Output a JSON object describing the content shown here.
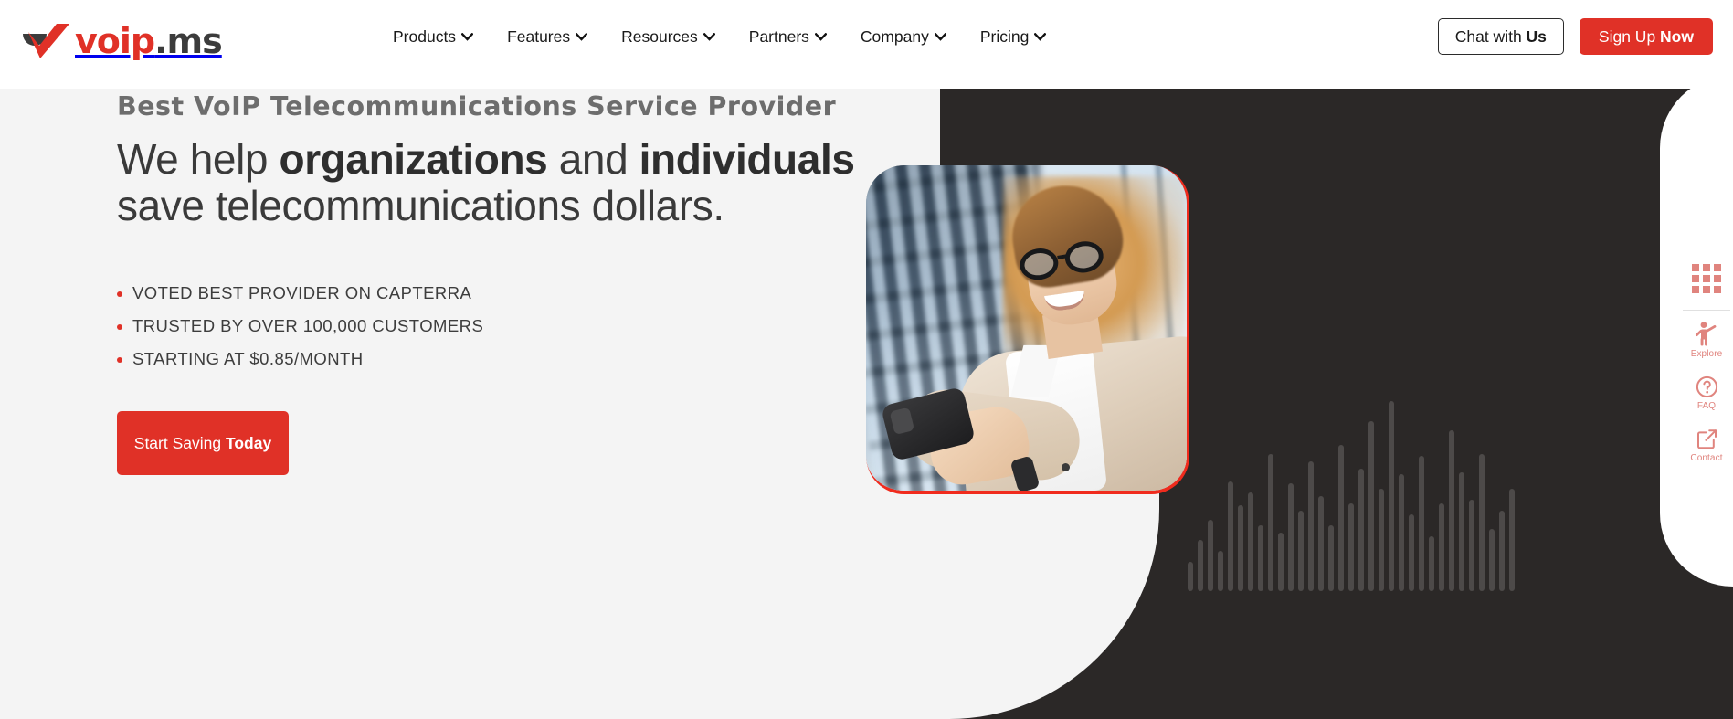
{
  "brand": {
    "logo_text_primary": "voip",
    "logo_text_secondary": ".ms",
    "accent_red": "#e03127",
    "dark_panel": "#2b2827",
    "rail_salmon": "#e0847e",
    "page_bg": "#f4f4f4"
  },
  "nav": {
    "items": [
      {
        "label": "Products",
        "icon": "chevron-down-icon"
      },
      {
        "label": "Features",
        "icon": "chevron-down-icon"
      },
      {
        "label": "Resources",
        "icon": "chevron-down-icon"
      },
      {
        "label": "Partners",
        "icon": "chevron-down-icon"
      },
      {
        "label": "Company",
        "icon": "chevron-down-icon"
      },
      {
        "label": "Pricing",
        "icon": "chevron-down-icon"
      }
    ],
    "chat_button": {
      "text_regular": "Chat with ",
      "text_bold": "Us"
    },
    "signup_button": {
      "text_regular": "Sign Up ",
      "text_bold": "Now"
    }
  },
  "hero": {
    "eyebrow": "Best VoIP Telecommunications Service Provider",
    "headline": {
      "line1_a": "We help ",
      "line1_b": "organizations",
      "line1_c": " and ",
      "line1_d": "individuals",
      "line2": "save telecommunications dollars."
    },
    "bullets": [
      "VOTED BEST PROVIDER ON CAPTERRA",
      "TRUSTED BY OVER 100,000 CUSTOMERS",
      "STARTING AT $0.85/MONTH"
    ],
    "cta": {
      "text_regular": "Start Saving ",
      "text_bold": "Today"
    },
    "image_alt": "Smiling woman with glasses holding a smartphone outside a glass office building"
  },
  "waveform": {
    "bars": [
      32,
      56,
      78,
      44,
      120,
      94,
      108,
      72,
      150,
      64,
      118,
      88,
      142,
      104,
      72,
      160,
      96,
      134,
      186,
      112,
      208,
      128,
      84,
      148,
      60,
      96,
      176,
      130,
      100,
      150,
      68,
      88,
      112
    ]
  },
  "right_rail": {
    "grid_icon": "grid-3x3-icon",
    "items": [
      {
        "label": "Explore",
        "icon": "person-waving-icon"
      },
      {
        "label": "FAQ",
        "icon": "question-circle-icon"
      },
      {
        "label": "Contact",
        "icon": "external-link-icon"
      }
    ]
  }
}
